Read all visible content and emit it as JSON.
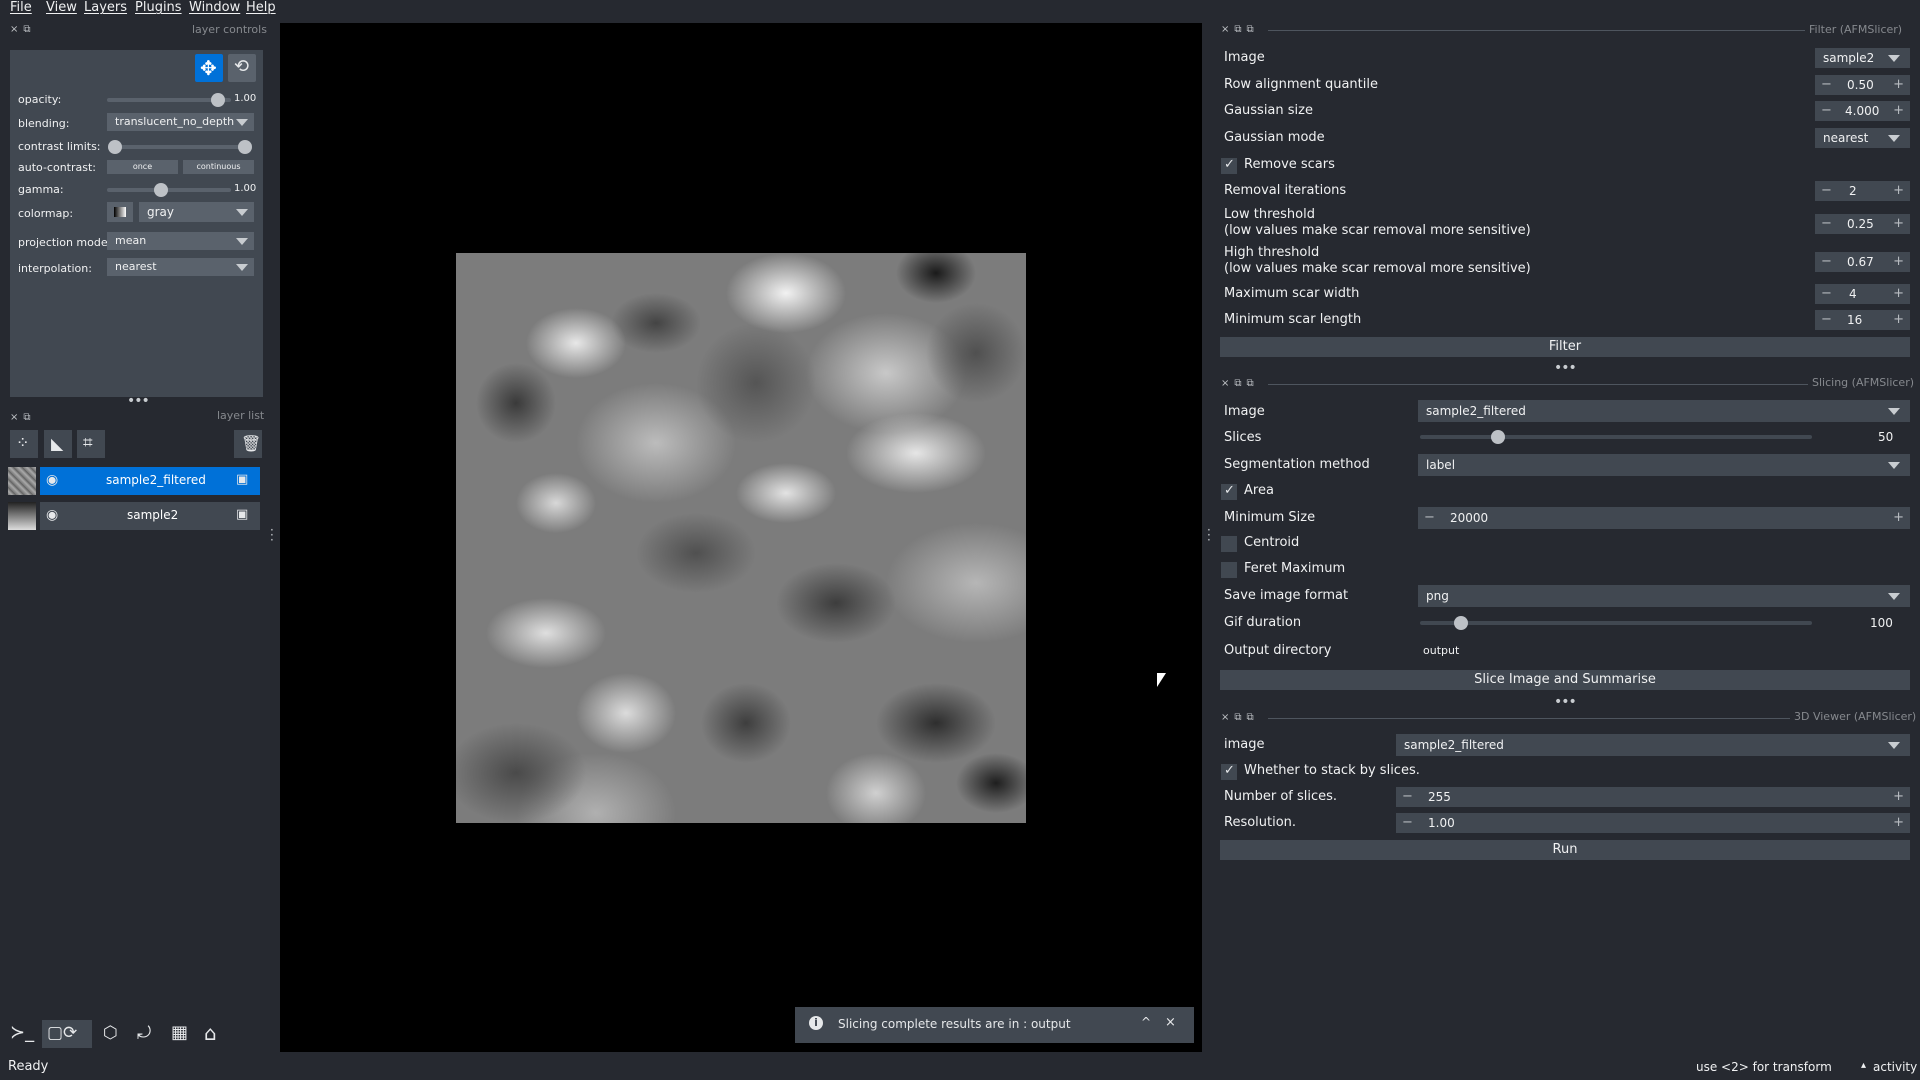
{
  "menu": [
    "File",
    "View",
    "Layers",
    "Plugins",
    "Window",
    "Help"
  ],
  "layer_controls": {
    "title": "layer controls",
    "opacity_label": "opacity:",
    "opacity_value": "1.00",
    "blending_label": "blending:",
    "blending_value": "translucent_no_depth",
    "contrast_label": "contrast limits:",
    "autocontrast_label": "auto-contrast:",
    "once_label": "once",
    "continuous_label": "continuous",
    "gamma_label": "gamma:",
    "gamma_value": "1.00",
    "colormap_label": "colormap:",
    "colormap_value": "gray",
    "projection_label": "projection mode:",
    "projection_value": "mean",
    "interpolation_label": "interpolation:",
    "interpolation_value": "nearest"
  },
  "layer_list": {
    "title": "layer list",
    "layers": [
      {
        "name": "sample2_filtered",
        "selected": true
      },
      {
        "name": "sample2",
        "selected": false
      }
    ]
  },
  "filter_panel": {
    "title": "Filter (AFMSlicer)",
    "image_label": "Image",
    "image_value": "sample2",
    "row_align_label": "Row alignment quantile",
    "row_align_value": "0.50",
    "gauss_size_label": "Gaussian size",
    "gauss_size_value": "4.000",
    "gauss_mode_label": "Gaussian mode",
    "gauss_mode_value": "nearest",
    "remove_scars_label": "Remove scars",
    "removal_iter_label": "Removal iterations",
    "removal_iter_value": "2",
    "low_thr_label": "Low threshold",
    "low_thr_sub": "(low values make scar removal more sensitive)",
    "low_thr_value": "0.25",
    "high_thr_label": "High threshold",
    "high_thr_sub": "(low values make scar removal more sensitive)",
    "high_thr_value": "0.67",
    "max_scar_label": "Maximum scar width",
    "max_scar_value": "4",
    "min_scar_label": "Minimum scar length",
    "min_scar_value": "16",
    "filter_button": "Filter"
  },
  "slicing_panel": {
    "title": "Slicing (AFMSlicer)",
    "image_label": "Image",
    "image_value": "sample2_filtered",
    "slices_label": "Slices",
    "slices_value": "50",
    "seg_label": "Segmentation method",
    "seg_value": "label",
    "area_label": "Area",
    "min_size_label": "Minimum Size",
    "min_size_value": "20000",
    "centroid_label": "Centroid",
    "feret_label": "Feret Maximum",
    "save_fmt_label": "Save image format",
    "save_fmt_value": "png",
    "gif_label": "Gif duration",
    "gif_value": "100",
    "outdir_label": "Output directory",
    "outdir_value": "output",
    "slice_button": "Slice Image and Summarise"
  },
  "viewer_panel": {
    "title": "3D Viewer (AFMSlicer)",
    "image_label": "image",
    "image_value": "sample2_filtered",
    "stack_label": "Whether to stack by slices.",
    "num_slices_label": "Number of slices.",
    "num_slices_value": "255",
    "resolution_label": "Resolution.",
    "resolution_value": "1.00",
    "run_button": "Run"
  },
  "notification": {
    "text": "Slicing complete results are in  : output"
  },
  "status": {
    "left": "Ready",
    "hint": "use <2> for transform",
    "activity": "activity"
  }
}
